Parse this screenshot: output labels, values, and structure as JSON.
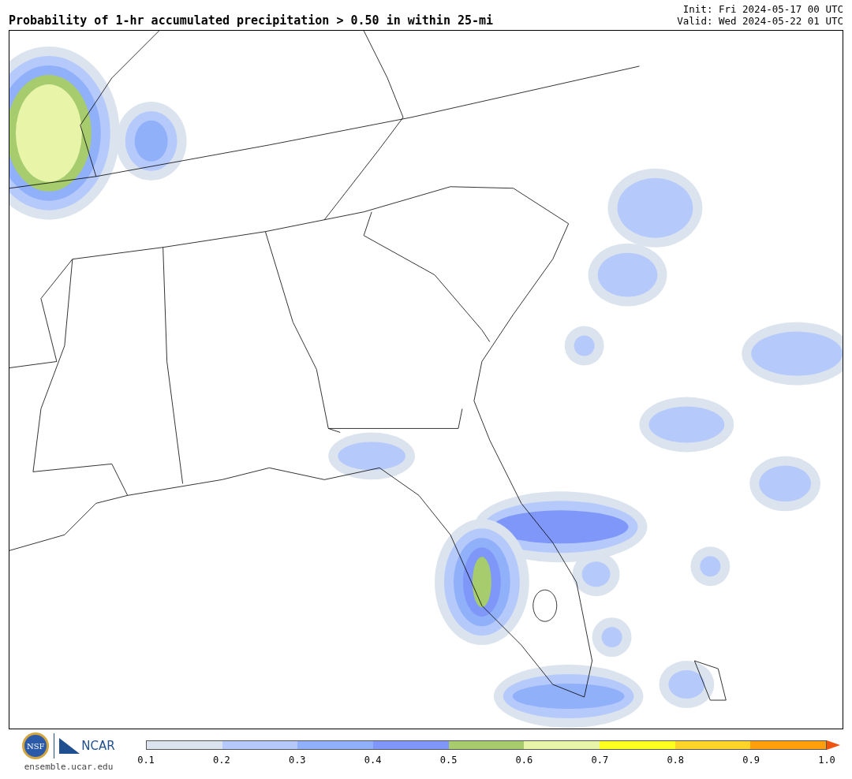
{
  "title": "Probability of 1-hr accumulated precipitation > 0.50 in within 25-mi",
  "init": "Init: Fri 2024-05-17 00 UTC",
  "valid": "Valid: Wed 2024-05-22 01 UTC",
  "logos": {
    "nsf": "NSF",
    "ncar": "NCAR",
    "url": "ensemble.ucar.edu"
  },
  "colorbar": {
    "bins": [
      {
        "color": "#dbe4ee"
      },
      {
        "color": "#b5c9fb"
      },
      {
        "color": "#91b0fa"
      },
      {
        "color": "#7e97f8"
      },
      {
        "color": "#a6cc6e"
      },
      {
        "color": "#e8f5a8"
      },
      {
        "color": "#ffff1f"
      },
      {
        "color": "#ffd42a"
      },
      {
        "color": "#ff9f0d"
      }
    ],
    "extension": {
      "color": "#ee5511"
    },
    "ticks": [
      "0.1",
      "0.2",
      "0.3",
      "0.4",
      "0.5",
      "0.6",
      "0.7",
      "0.8",
      "0.9",
      "1.0"
    ]
  }
}
